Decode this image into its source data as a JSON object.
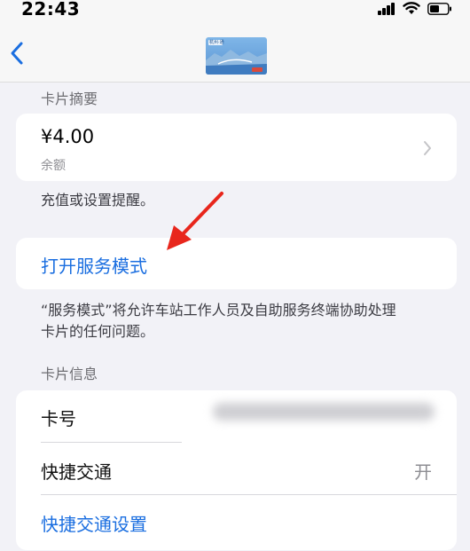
{
  "status_bar": {
    "time": "22:43"
  },
  "nav": {
    "card_image_caption": "杭州·通"
  },
  "summary": {
    "section_label": "卡片摘要",
    "balance_amount": "¥4.00",
    "balance_label": "余额",
    "footnote": "充值或设置提醒。"
  },
  "service_mode": {
    "link_label": "打开服务模式",
    "description_line1": "“服务模式”将允许车站工作人员及自助服务终端协助处理",
    "description_line2": "卡片的任何问题。"
  },
  "card_info": {
    "section_label": "卡片信息",
    "card_number_label": "卡号",
    "express_transit_label": "快捷交通",
    "express_transit_value": "开",
    "express_transit_settings_label": "快捷交通设置"
  },
  "colors": {
    "accent": "#1a6ee0",
    "annotation_arrow": "#e8261c",
    "background": "#f2f2f7"
  },
  "icons": [
    "back-chevron-icon",
    "signal-icon",
    "wifi-icon",
    "battery-icon",
    "chevron-right-icon",
    "annotation-arrow-icon"
  ]
}
